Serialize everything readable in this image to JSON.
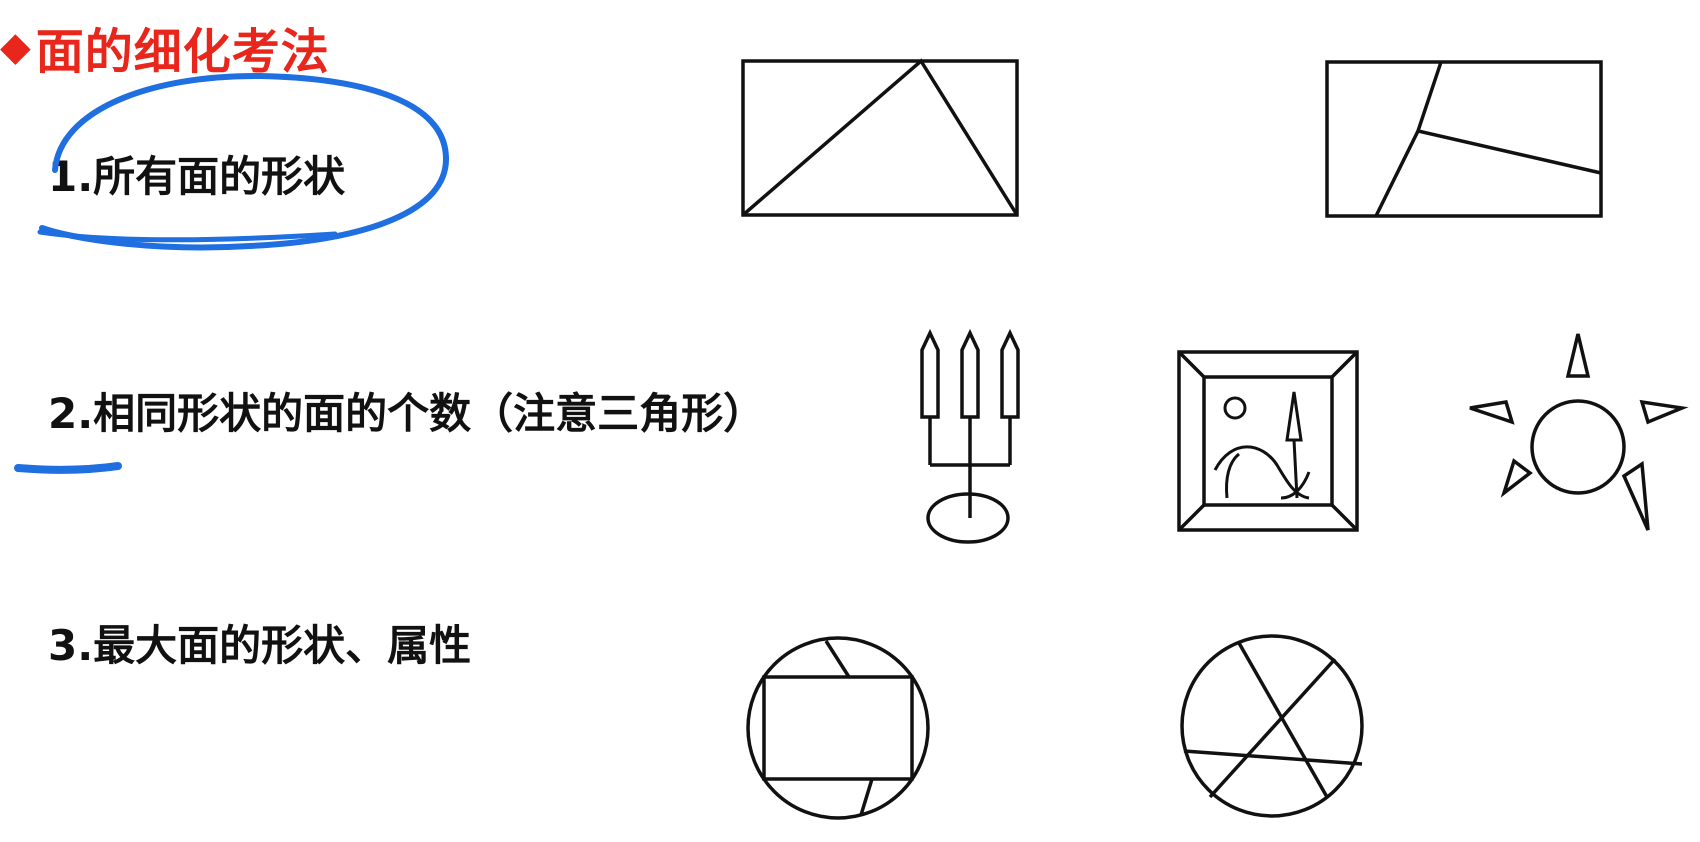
{
  "heading": {
    "bullet": "◆",
    "text": "面的细化考法"
  },
  "items": [
    {
      "label": "1.所有面的形状"
    },
    {
      "label": "2.相同形状的面的个数（注意三角形）"
    },
    {
      "label": "3.最大面的形状、属性"
    }
  ],
  "colors": {
    "heading": "#e8261b",
    "text": "#111111",
    "annotation_pen": "#1f6fe0"
  },
  "figures": [
    "rectangle-with-triangle",
    "rectangle-with-polyline",
    "candelabra",
    "framed-picture",
    "sun-with-triangles",
    "circle-with-rectangle",
    "circle-with-crossing-lines"
  ]
}
